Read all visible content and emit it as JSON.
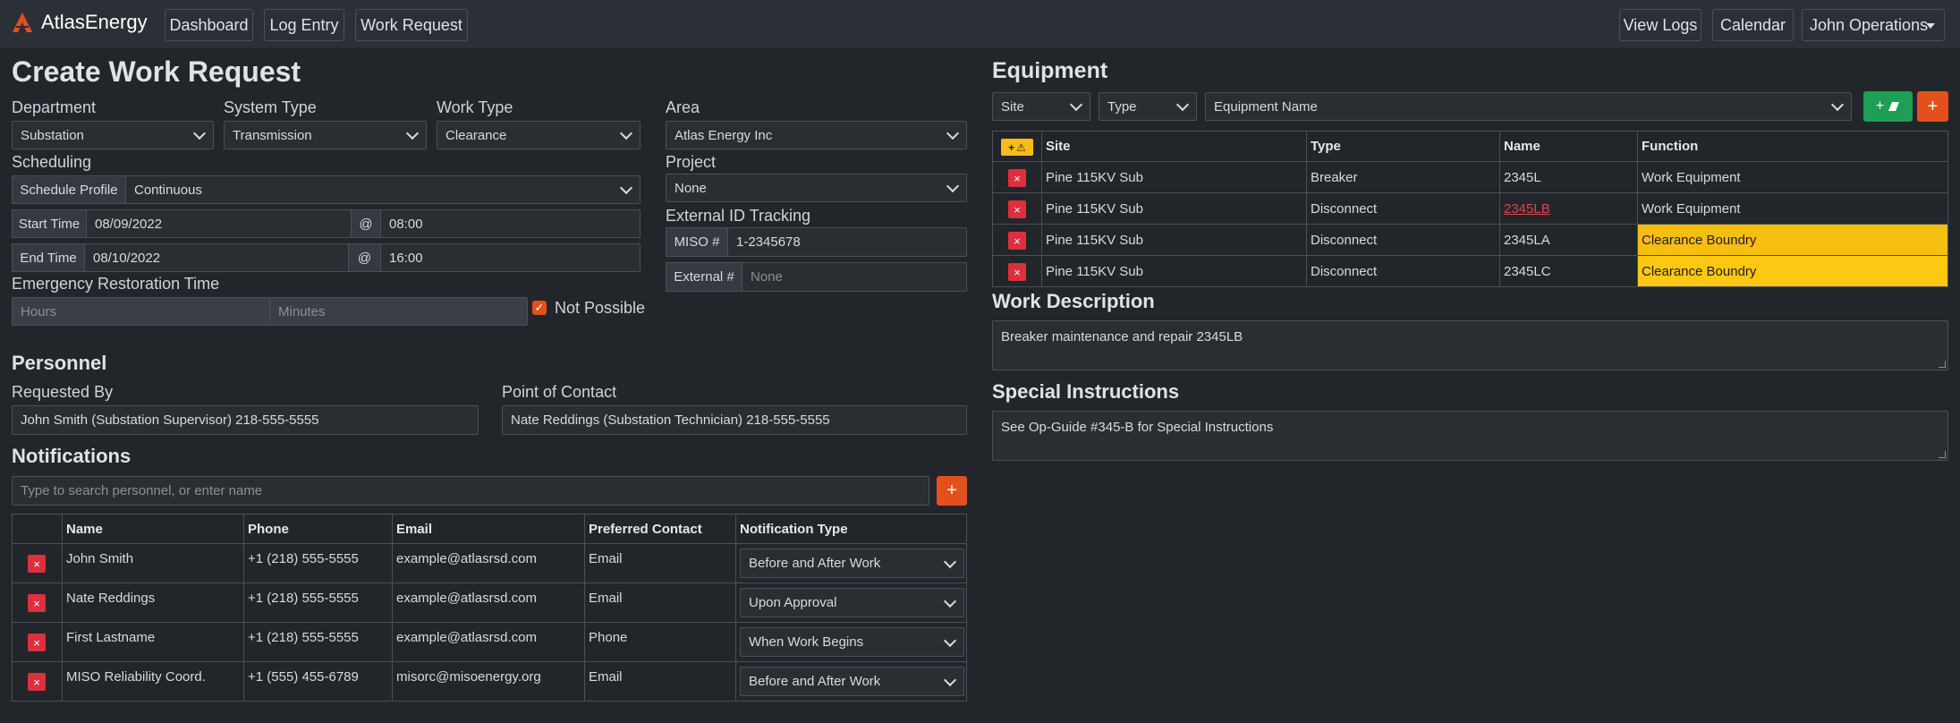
{
  "nav": {
    "brand": "AtlasEnergy",
    "links": [
      "Dashboard",
      "Log Entry",
      "Work Request"
    ],
    "right": [
      "View Logs",
      "Calendar",
      "John Operations"
    ]
  },
  "form": {
    "title": "Create Work Request",
    "department": {
      "label": "Department",
      "value": "Substation"
    },
    "system_type": {
      "label": "System Type",
      "value": "Transmission"
    },
    "work_type": {
      "label": "Work Type",
      "value": "Clearance"
    },
    "area": {
      "label": "Area",
      "value": "Atlas Energy Inc"
    },
    "scheduling": {
      "label": "Scheduling",
      "profile_label": "Schedule Profile",
      "profile_value": "Continuous",
      "start_label": "Start Time",
      "start_date": "08/09/2022",
      "start_time": "08:00",
      "end_label": "End Time",
      "end_date": "08/10/2022",
      "end_time": "16:00",
      "at": "@"
    },
    "project": {
      "label": "Project",
      "value": "None"
    },
    "external": {
      "label": "External ID Tracking",
      "miso_label": "MISO #",
      "miso_value": "1-2345678",
      "ext_label": "External #",
      "ext_placeholder": "None"
    },
    "ert": {
      "label": "Emergency Restoration Time",
      "hours_placeholder": "Hours",
      "minutes_placeholder": "Minutes",
      "not_possible": "Not Possible",
      "not_possible_checked": true
    }
  },
  "personnel": {
    "title": "Personnel",
    "requested_by_label": "Requested By",
    "requested_by": "John Smith (Substation Supervisor) 218-555-5555",
    "poc_label": "Point of Contact",
    "poc": "Nate Reddings (Substation Technician) 218-555-5555"
  },
  "notifications": {
    "title": "Notifications",
    "search_placeholder": "Type to search personnel, or enter name",
    "add": "+",
    "headers": [
      "Name",
      "Phone",
      "Email",
      "Preferred Contact",
      "Notification Type"
    ],
    "rows": [
      {
        "name": "John Smith",
        "phone": "+1 (218) 555-5555",
        "email": "example@atlasrsd.com",
        "contact": "Email",
        "type": "Before and After Work"
      },
      {
        "name": "Nate Reddings",
        "phone": "+1 (218) 555-5555",
        "email": "example@atlasrsd.com",
        "contact": "Email",
        "type": "Upon Approval"
      },
      {
        "name": "First Lastname",
        "phone": "+1 (218) 555-5555",
        "email": "example@atlasrsd.com",
        "contact": "Phone",
        "type": "When Work Begins"
      },
      {
        "name": "MISO Reliability Coord.",
        "phone": "+1 (555) 455-6789",
        "email": "misorc@misoenergy.org",
        "contact": "Email",
        "type": "Before and After Work"
      }
    ]
  },
  "equipment": {
    "title": "Equipment",
    "filter_site": "Site",
    "filter_type": "Type",
    "filter_name": "Equipment Name",
    "headers": [
      "Site",
      "Type",
      "Name",
      "Function"
    ],
    "rows": [
      {
        "site": "Pine 115KV Sub",
        "type": "Breaker",
        "name": "2345L",
        "function": "Work Equipment"
      },
      {
        "site": "Pine 115KV Sub",
        "type": "Disconnect",
        "name": "2345LB",
        "function": "Work Equipment"
      },
      {
        "site": "Pine 115KV Sub",
        "type": "Disconnect",
        "name": "2345LA",
        "function": "Clearance Boundry"
      },
      {
        "site": "Pine 115KV Sub",
        "type": "Disconnect",
        "name": "2345LC",
        "function": "Clearance Boundry"
      }
    ]
  },
  "work_description": {
    "title": "Work Description",
    "value": "Breaker maintenance and repair 2345LB"
  },
  "special_instructions": {
    "title": "Special Instructions",
    "value": "See Op-Guide #345-B for Special Instructions"
  },
  "icons": {
    "plus": "+",
    "x": "×",
    "warning": "⚠",
    "check": "✓"
  },
  "colors": {
    "accent": "#e3501d",
    "green": "#1f9e55",
    "danger": "#dd2f3d",
    "highlight": "#f6bd13"
  }
}
